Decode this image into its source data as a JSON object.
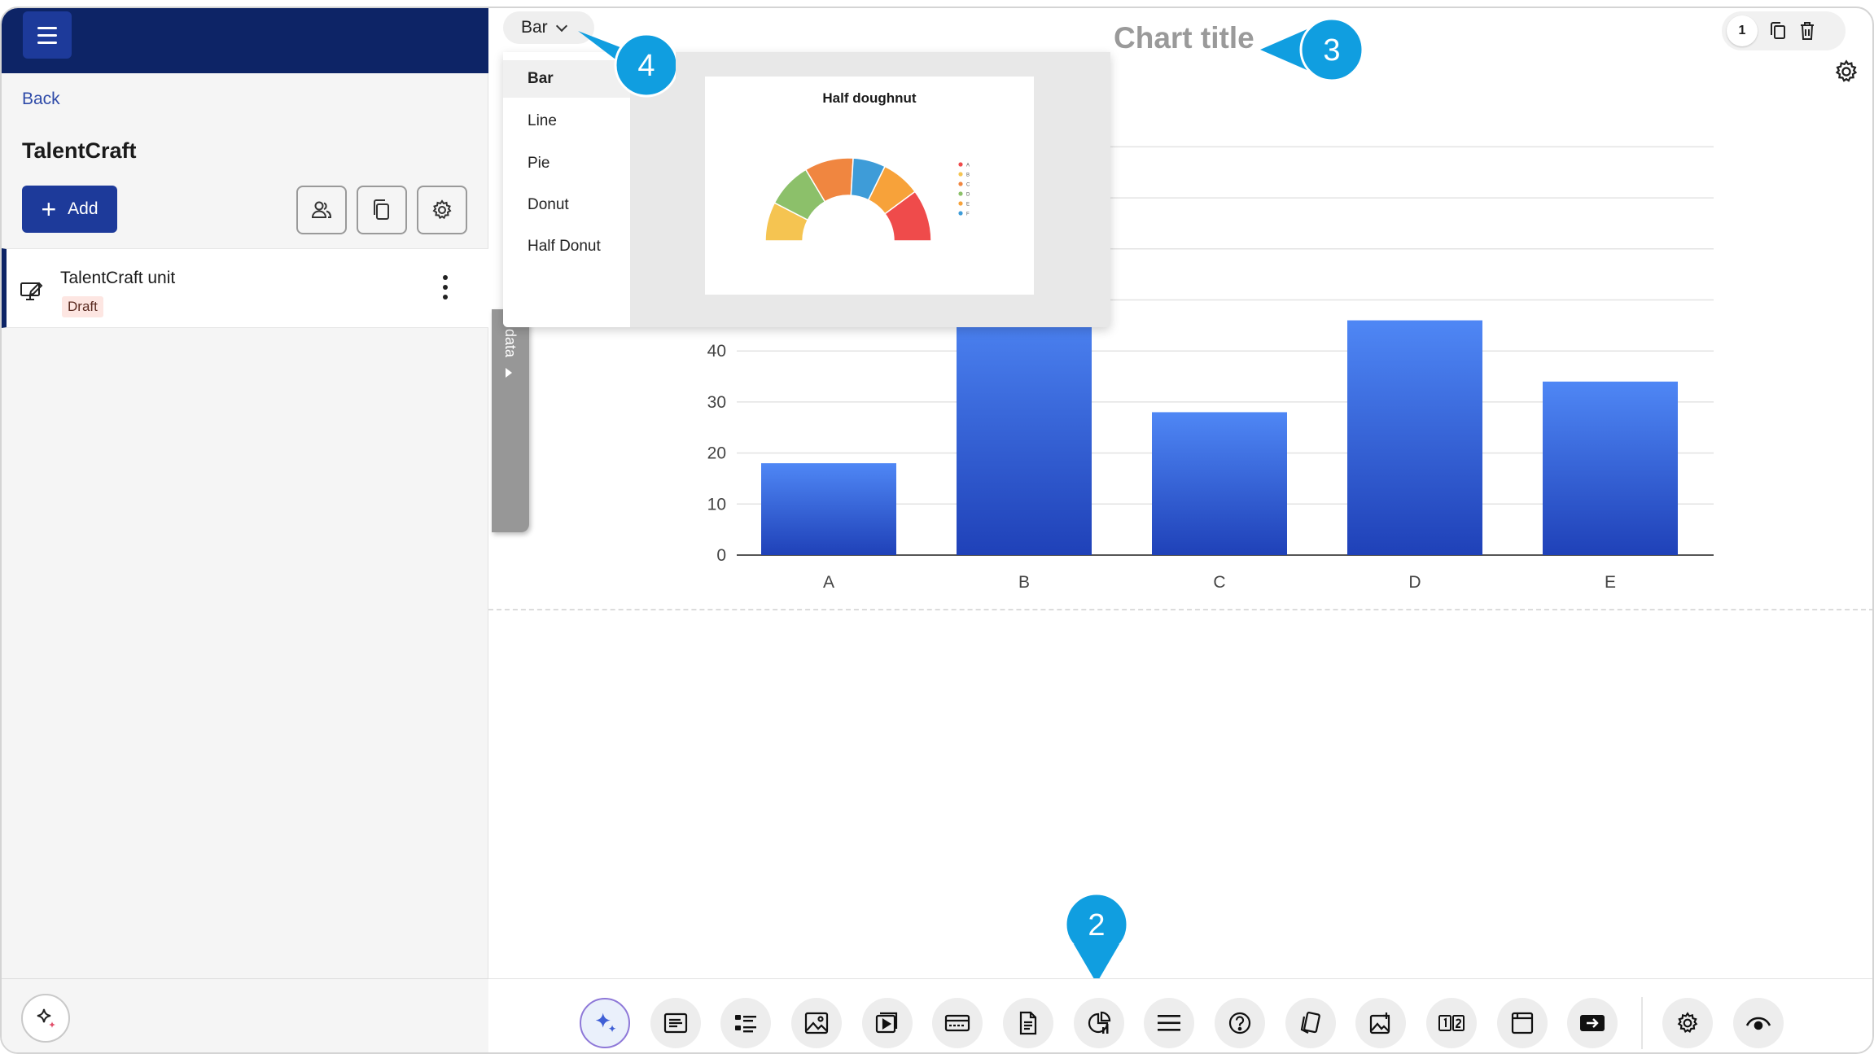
{
  "sidebar": {
    "back_label": "Back",
    "workspace_title": "TalentCraft",
    "add_label": "Add",
    "unit": {
      "name": "TalentCraft unit",
      "status": "Draft"
    }
  },
  "editor": {
    "chart_title": "Chart title",
    "slide_count": "1",
    "data_tab_label": "data"
  },
  "chart_type_menu": {
    "selected": "Bar",
    "options": [
      "Bar",
      "Line",
      "Pie",
      "Donut",
      "Half Donut"
    ],
    "preview_title": "Half doughnut",
    "preview_legend": [
      "A",
      "B",
      "C",
      "D",
      "E",
      "F"
    ],
    "preview_colors": [
      "#f5c451",
      "#8cc06a",
      "#f08640",
      "#3e9cd8",
      "#f7a23a",
      "#ef4b4b"
    ]
  },
  "callouts": [
    "2",
    "3",
    "4"
  ],
  "colors": {
    "brand_dark": "#0d2466",
    "brand": "#1d3a9a",
    "callout": "#109ee0",
    "bar_top": "#4f87f5",
    "bar_bottom": "#1f41b8"
  },
  "chart_data": {
    "type": "bar",
    "categories": [
      "A",
      "B",
      "C",
      "D",
      "E"
    ],
    "values": [
      18,
      50,
      28,
      46,
      34
    ],
    "ylim": [
      0,
      80
    ],
    "yticks_visible": [
      0,
      10,
      20,
      30,
      40
    ],
    "gridlines": [
      0,
      10,
      20,
      30,
      40,
      50,
      60,
      70,
      80
    ],
    "grid": true
  },
  "toolbar": {
    "icons": [
      "ai-sparkle-icon",
      "text-block-icon",
      "list-icon",
      "image-icon",
      "video-icon",
      "carousel-icon",
      "document-icon",
      "chart-icon",
      "divider-icon",
      "question-icon",
      "flashcards-icon",
      "image-hotspot-icon",
      "flip-card-icon",
      "window-icon",
      "continue-button-icon",
      "settings-icon",
      "preview-icon"
    ]
  }
}
